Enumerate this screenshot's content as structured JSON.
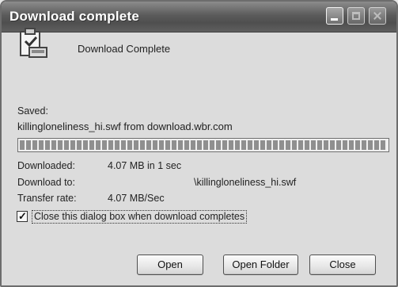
{
  "window": {
    "title": "Download complete"
  },
  "header": {
    "label": "Download Complete",
    "icon": "download-complete-icon"
  },
  "saved": {
    "label": "Saved:",
    "filename": "killingloneliness_hi.swf from download.wbr.com"
  },
  "progress": {
    "value": 1.0
  },
  "details": {
    "downloaded_label": "Downloaded:",
    "downloaded_value": "4.07 MB in 1 sec",
    "download_to_label": "Download to:",
    "download_to_value": "\\killingloneliness_hi.swf",
    "transfer_rate_label": "Transfer rate:",
    "transfer_rate_value": "4.07 MB/Sec"
  },
  "options": {
    "close_when_done_label": "Close this dialog box when download completes",
    "close_when_done_checked": true
  },
  "buttons": {
    "open_label": "Open",
    "open_folder_label": "Open Folder",
    "close_label": "Close"
  }
}
